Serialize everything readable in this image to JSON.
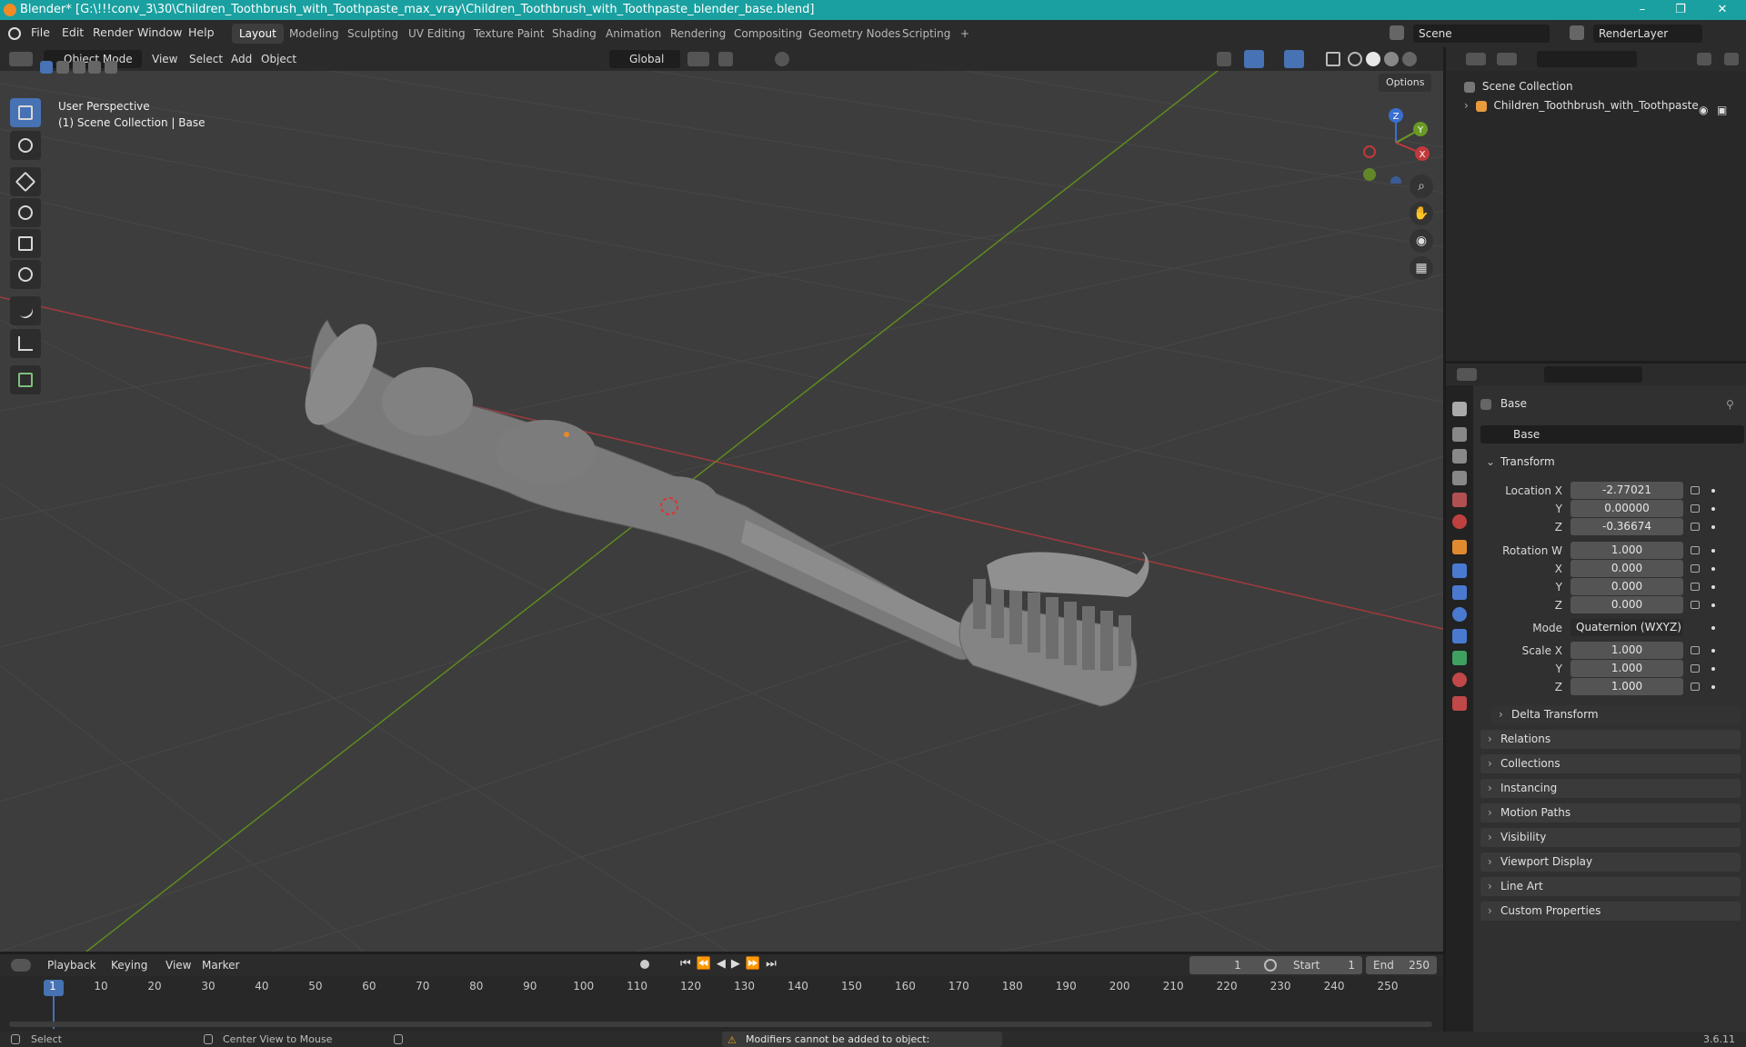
{
  "titlebar": {
    "title": "Blender* [G:\\!!!conv_3\\30\\Children_Toothbrush_with_Toothpaste_max_vray\\Children_Toothbrush_with_Toothpaste_blender_base.blend]",
    "minimize": "–",
    "maximize": "❐",
    "close": "✕"
  },
  "menu": [
    "File",
    "Edit",
    "Render",
    "Window",
    "Help"
  ],
  "workspaces": [
    "Layout",
    "Modeling",
    "Sculpting",
    "UV Editing",
    "Texture Paint",
    "Shading",
    "Animation",
    "Rendering",
    "Compositing",
    "Geometry Nodes",
    "Scripting",
    "+"
  ],
  "active_workspace": "Layout",
  "scene": "Scene",
  "render_layer": "RenderLayer",
  "viewport": {
    "mode": "Object Mode",
    "menus": [
      "View",
      "Select",
      "Add",
      "Object"
    ],
    "orientation": "Global",
    "options": "Options",
    "overlay_line1": "User Perspective",
    "overlay_line2": "(1) Scene Collection | Base",
    "gizmo": {
      "x": "X",
      "y": "Y",
      "z": "Z"
    }
  },
  "outliner": {
    "root": "Scene Collection",
    "items": [
      "Children_Toothbrush_with_Toothpaste"
    ]
  },
  "properties": {
    "object_name": "Base",
    "data_name": "Base",
    "transform_label": "Transform",
    "location": {
      "label": "Location X",
      "x": "-2.77021",
      "y": "0.00000",
      "z": "-0.36674"
    },
    "rotation": {
      "label": "Rotation W",
      "w": "1.000",
      "x": "0.000",
      "y": "0.000",
      "z": "0.000"
    },
    "mode_label": "Mode",
    "mode_value": "Quaternion (WXYZ)",
    "scale": {
      "label": "Scale X",
      "x": "1.000",
      "y": "1.000",
      "z": "1.000"
    },
    "axis_y": "Y",
    "axis_z": "Z",
    "axis_x": "X",
    "delta": "Delta Transform",
    "sections": [
      "Relations",
      "Collections",
      "Instancing",
      "Motion Paths",
      "Visibility",
      "Viewport Display",
      "Line Art",
      "Custom Properties"
    ]
  },
  "timeline": {
    "menus": [
      "Playback",
      "Keying",
      "View",
      "Marker"
    ],
    "current_frame": "1",
    "start_label": "Start",
    "start": "1",
    "end_label": "End",
    "end": "250",
    "ticks": [
      "1",
      "10",
      "20",
      "30",
      "40",
      "50",
      "60",
      "70",
      "80",
      "90",
      "100",
      "110",
      "120",
      "130",
      "140",
      "150",
      "160",
      "170",
      "180",
      "190",
      "200",
      "210",
      "220",
      "230",
      "240",
      "250"
    ]
  },
  "statusbar": {
    "select": "Select",
    "center": "Center View to Mouse",
    "warning": "Modifiers cannot be added to object: Toothbrush_Kids",
    "version": "3.6.11"
  },
  "colors": {
    "accent": "#4772b3",
    "titlebar": "#1aa0a0",
    "x_axis": "#c0393d",
    "y_axis": "#6a9a23",
    "z_axis": "#3a6fd0"
  }
}
